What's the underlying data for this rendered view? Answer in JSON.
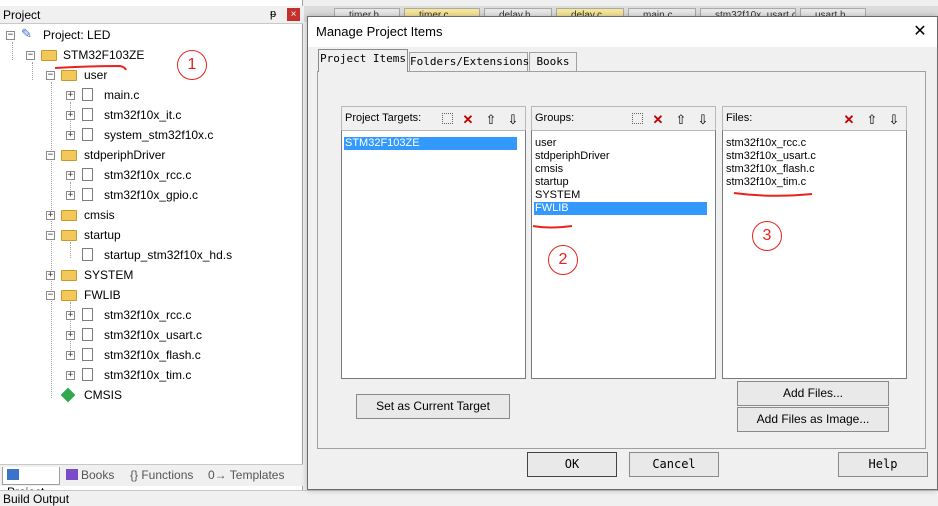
{
  "project_panel": {
    "title": "Project",
    "pin": "ᵽ",
    "close": "×",
    "tree": {
      "root": "Project: LED",
      "target": "STM32F103ZE",
      "groups": [
        {
          "name": "user",
          "files": [
            "main.c",
            "stm32f10x_it.c",
            "system_stm32f10x.c"
          ]
        },
        {
          "name": "stdperiphDriver",
          "files": [
            "stm32f10x_rcc.c",
            "stm32f10x_gpio.c"
          ]
        },
        {
          "name": "cmsis",
          "files": []
        },
        {
          "name": "startup",
          "files": [
            "startup_stm32f10x_hd.s"
          ]
        },
        {
          "name": "SYSTEM",
          "files": []
        },
        {
          "name": "FWLIB",
          "files": [
            "stm32f10x_rcc.c",
            "stm32f10x_usart.c",
            "stm32f10x_flash.c",
            "stm32f10x_tim.c"
          ]
        }
      ],
      "cmsis_item": "CMSIS"
    },
    "tabs": [
      "Project",
      "Books",
      "{} Functions",
      "0→ Templates"
    ]
  },
  "editor_tabs": [
    "timer.h",
    "timer.c",
    "delay.h",
    "delay.c",
    "main.c",
    "stm32f10x_usart.c",
    "usart.h"
  ],
  "build_output": "Build Output",
  "dialog": {
    "title": "Manage Project Items",
    "close": "✕",
    "tabs": [
      "Project Items",
      "Folders/Extensions",
      "Books"
    ],
    "targets": {
      "label": "Project Targets:",
      "items": [
        "STM32F103ZE"
      ],
      "selected": 0
    },
    "groups": {
      "label": "Groups:",
      "items": [
        "user",
        "stdperiphDriver",
        "cmsis",
        "startup",
        "SYSTEM",
        "FWLIB"
      ],
      "selected": 5
    },
    "files": {
      "label": "Files:",
      "items": [
        "stm32f10x_rcc.c",
        "stm32f10x_usart.c",
        "stm32f10x_flash.c",
        "stm32f10x_tim.c"
      ]
    },
    "buttons": {
      "set_current": "Set as Current Target",
      "add_files": "Add Files...",
      "add_files_image": "Add Files as Image...",
      "ok": "OK",
      "cancel": "Cancel",
      "help": "Help"
    },
    "toolbar": {
      "new": "",
      "delete": "✕",
      "up": "🡡",
      "down": "🡣"
    }
  },
  "annotations": [
    "1",
    "2",
    "3"
  ],
  "colors": {
    "selection": "#3399ff",
    "annotation": "#e8231f"
  }
}
